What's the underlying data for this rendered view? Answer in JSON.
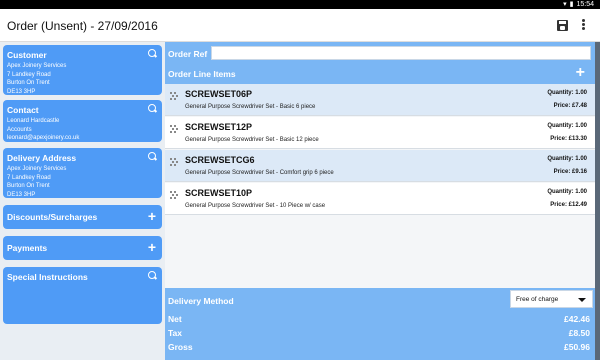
{
  "status": {
    "time": "15:54"
  },
  "header": {
    "title": "Order (Unsent) - 27/09/2016"
  },
  "sidebar": {
    "customer": {
      "title": "Customer",
      "lines": [
        "Apex Joinery Services",
        "7 Landkey Road",
        "Burton On Trent",
        "DE13 3HP"
      ]
    },
    "contact": {
      "title": "Contact",
      "lines": [
        "Leonard Hardcastle",
        "Accounts",
        "leonard@apexjoinery.co.uk"
      ]
    },
    "delivery": {
      "title": "Delivery Address",
      "lines": [
        "Apex Joinery Services",
        "7 Landkey Road",
        "Burton On Trent",
        "DE13 3HP"
      ]
    },
    "discounts": {
      "title": "Discounts/Surcharges"
    },
    "payments": {
      "title": "Payments"
    },
    "special": {
      "title": "Special Instructions"
    }
  },
  "order_ref": {
    "label": "Order Ref",
    "value": ""
  },
  "order_lines": {
    "label": "Order Line Items",
    "items": [
      {
        "code": "SCREWSET06P",
        "desc": "General Purpose Screwdriver Set - Basic 6 piece",
        "qty": "Quantity: 1.00",
        "price": "Price: £7.48"
      },
      {
        "code": "SCREWSET12P",
        "desc": "General Purpose Screwdriver Set - Basic 12 piece",
        "qty": "Quantity: 1.00",
        "price": "Price: £13.30"
      },
      {
        "code": "SCREWSETCG6",
        "desc": "General Purpose Screwdriver Set - Comfort grip 6 piece",
        "qty": "Quantity: 1.00",
        "price": "Price: £9.16"
      },
      {
        "code": "SCREWSET10P",
        "desc": "General Purpose Screwdriver Set - 10 Piece w/ case",
        "qty": "Quantity: 1.00",
        "price": "Price: £12.49"
      }
    ]
  },
  "delivery_method": {
    "label": "Delivery Method",
    "selected": "Free of charge"
  },
  "totals": {
    "net_label": "Net",
    "net": "£42.46",
    "tax_label": "Tax",
    "tax": "£8.50",
    "gross_label": "Gross",
    "gross": "£50.96"
  }
}
